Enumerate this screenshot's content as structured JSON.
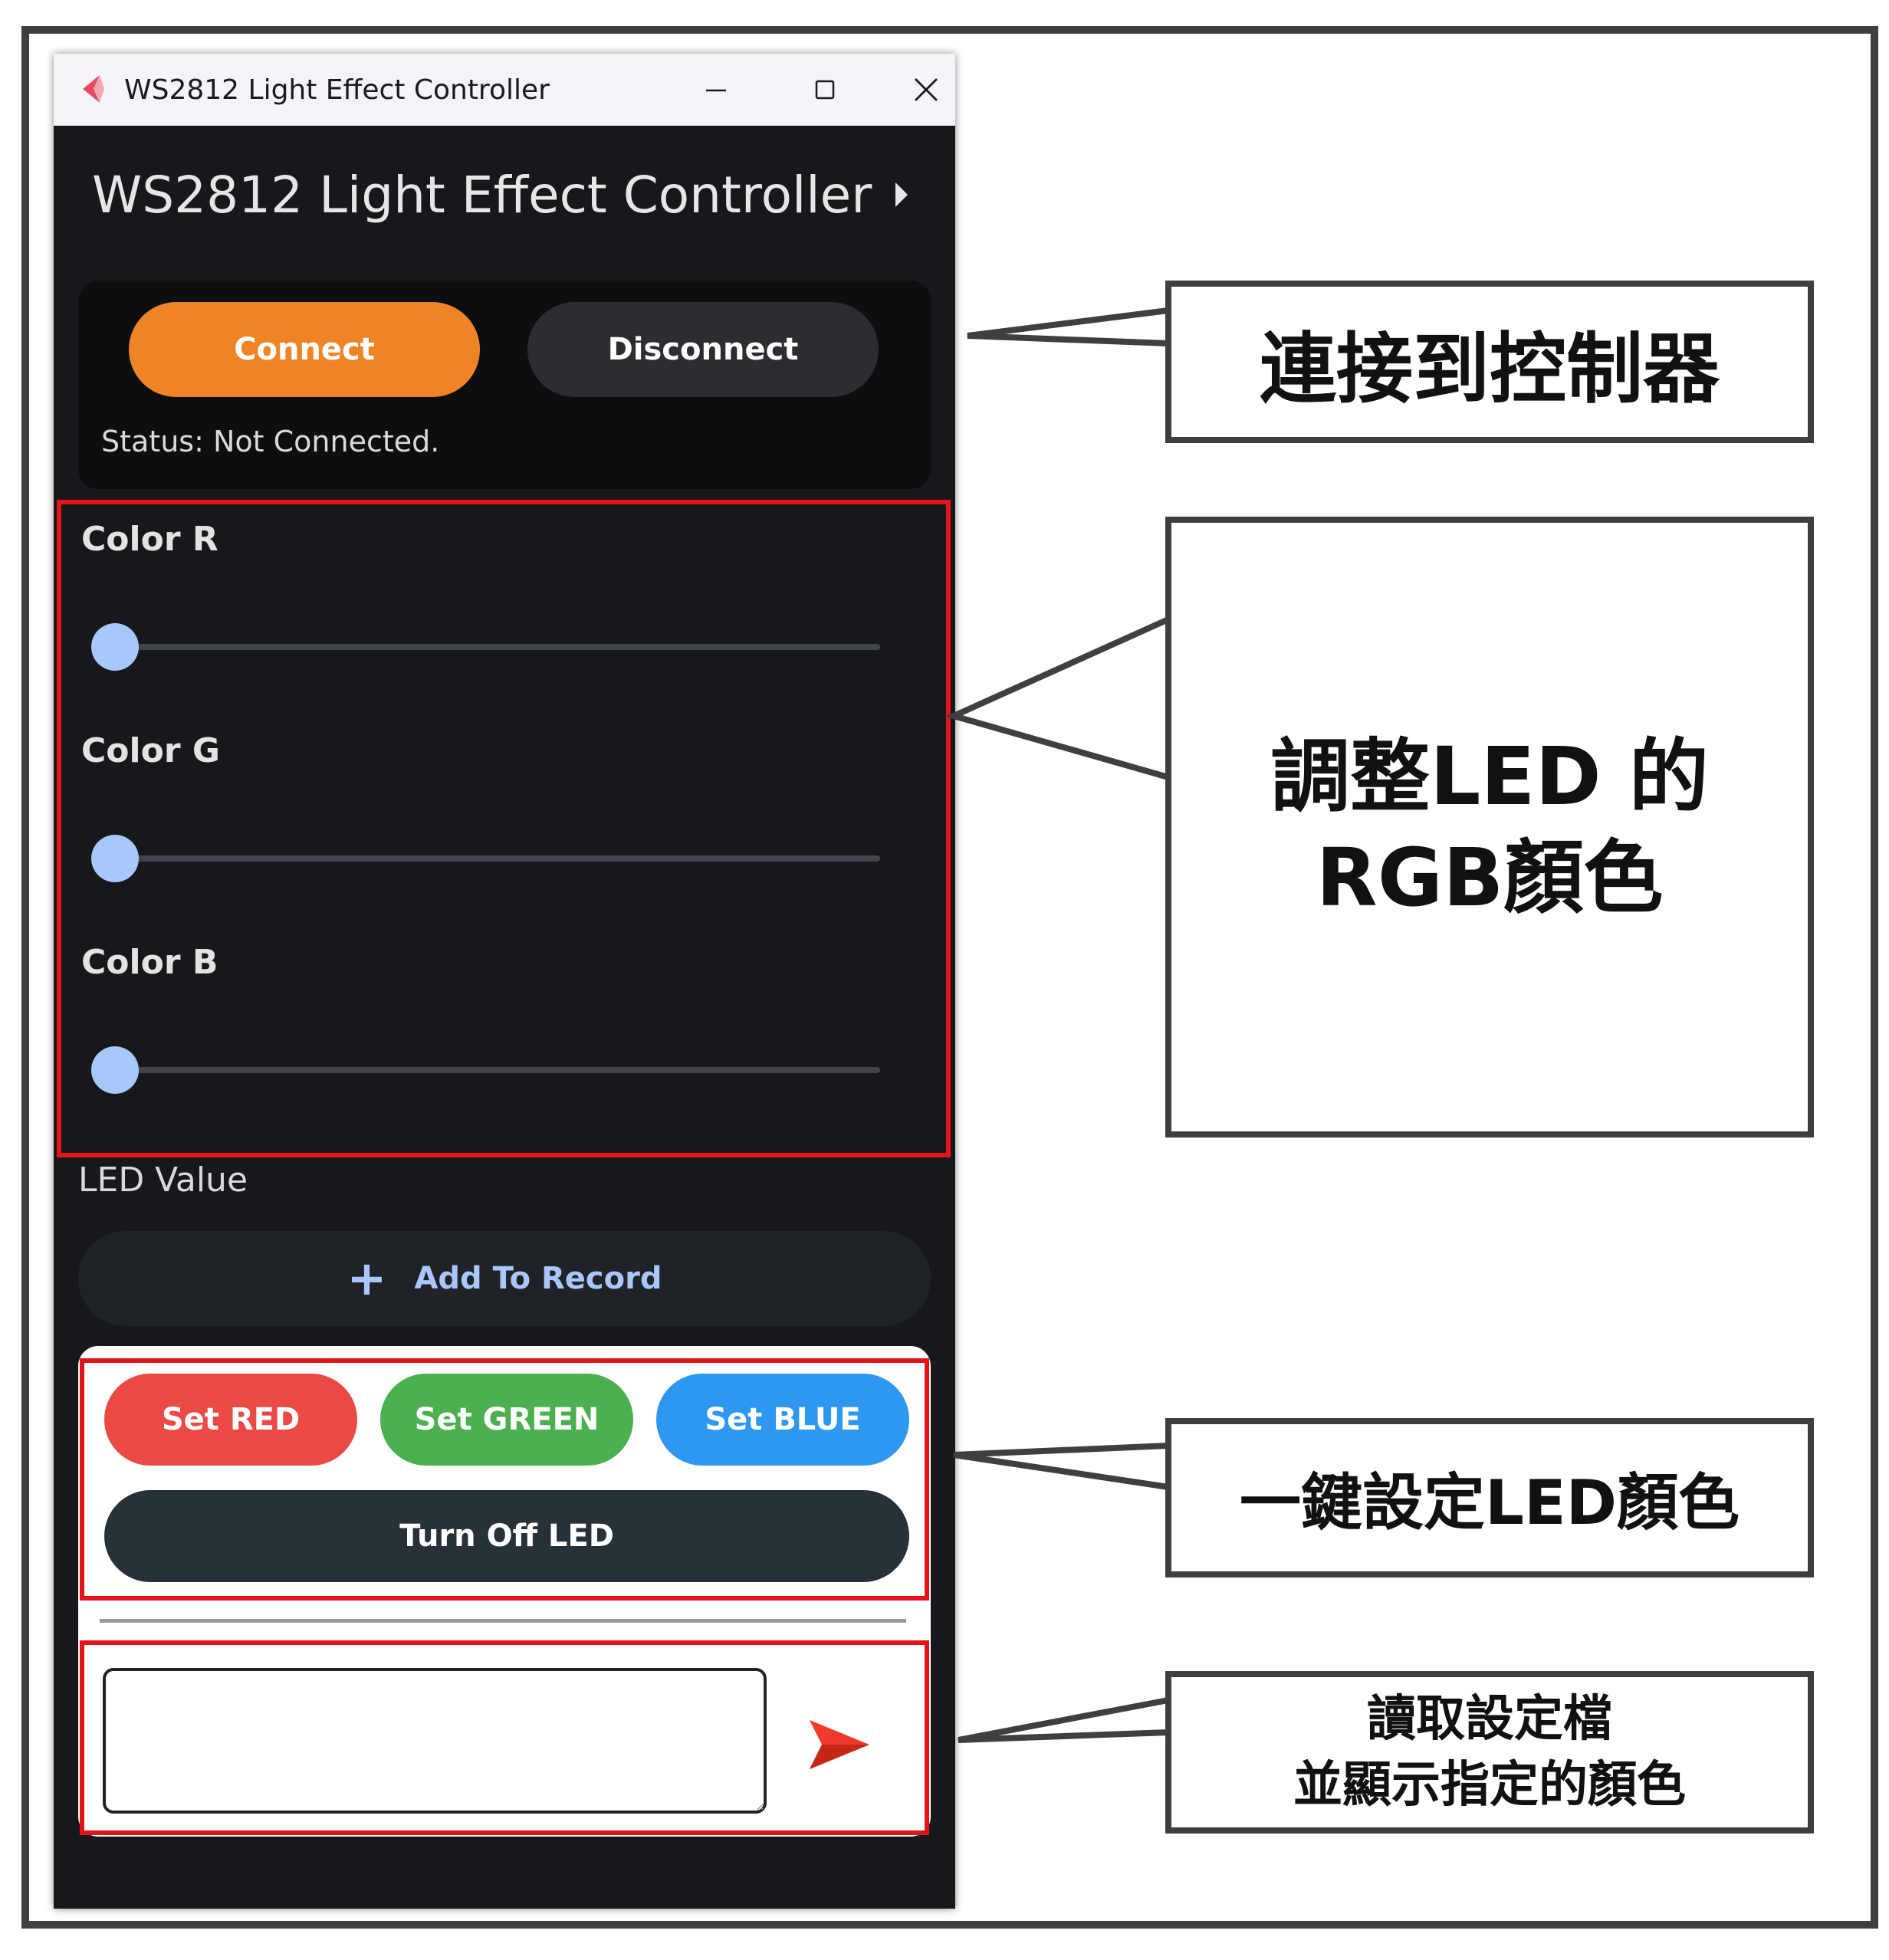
{
  "window": {
    "title": "WS2812 Light Effect Controller",
    "controls": {
      "minimize": "—",
      "maximize": "☐",
      "close": "✕"
    }
  },
  "app": {
    "header": "WS2812 Light Effect Controller"
  },
  "connection": {
    "connect_label": "Connect",
    "disconnect_label": "Disconnect",
    "status": "Status: Not Connected."
  },
  "colors_section": {
    "sliders": [
      {
        "label": "Color R",
        "value_fraction": 0
      },
      {
        "label": "Color G",
        "value_fraction": 0
      },
      {
        "label": "Color B",
        "value_fraction": 0
      }
    ]
  },
  "led_value_label": "LED Value",
  "add_record": {
    "label": "Add To Record",
    "icon": "plus-icon"
  },
  "quick_set": {
    "red_label": "Set RED",
    "green_label": "Set GREEN",
    "blue_label": "Set BLUE",
    "off_label": "Turn Off LED"
  },
  "file_input": {
    "value": "",
    "send_icon": "send-icon"
  },
  "callouts": {
    "connect": "連接到控制器",
    "rgb": "調整LED 的\nRGB顏色",
    "quick": "一鍵設定LED顏色",
    "file": "讀取設定檔\n並顯示指定的顏色"
  },
  "theme": {
    "accent_orange": "#ef8426",
    "red": "#ea4a43",
    "green": "#4caf50",
    "blue": "#2d97f2",
    "slider": "#a7c8fb",
    "highlight": "#e4141b"
  }
}
